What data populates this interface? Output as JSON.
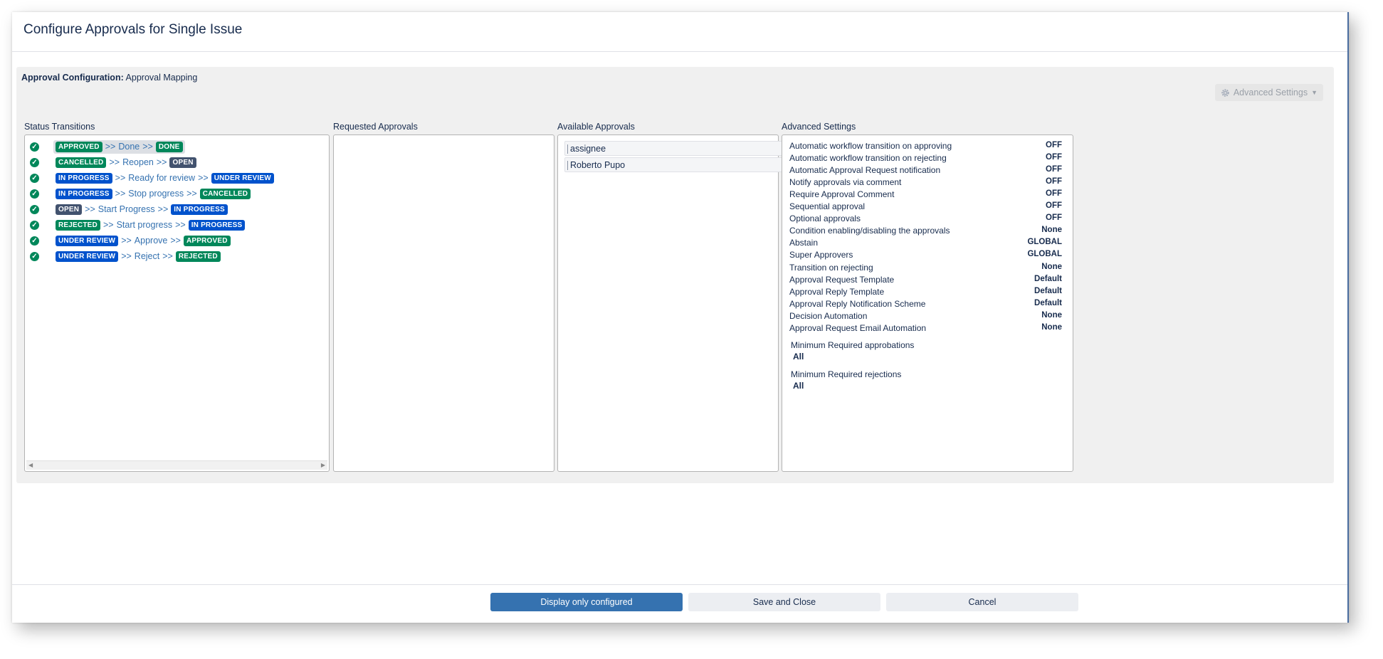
{
  "dialog": {
    "title": "Configure Approvals for Single Issue"
  },
  "config": {
    "label": "Approval Configuration:",
    "value": "Approval Mapping"
  },
  "advanced_button": {
    "label": "Advanced Settings",
    "icon": "gear-icon"
  },
  "columns": {
    "status_transitions": "Status Transitions",
    "requested_approvals": "Requested Approvals",
    "available_approvals": "Available Approvals",
    "advanced_settings": "Advanced Settings"
  },
  "transitions": [
    {
      "from": "APPROVED",
      "from_color": "green",
      "action": "Done",
      "to": "DONE",
      "to_color": "green",
      "selected": true
    },
    {
      "from": "CANCELLED",
      "from_color": "green",
      "action": "Reopen",
      "to": "OPEN",
      "to_color": "dark",
      "selected": false
    },
    {
      "from": "IN PROGRESS",
      "from_color": "blue",
      "action": "Ready for review",
      "to": "UNDER REVIEW",
      "to_color": "blue",
      "selected": false
    },
    {
      "from": "IN PROGRESS",
      "from_color": "blue",
      "action": "Stop progress",
      "to": "CANCELLED",
      "to_color": "green",
      "selected": false
    },
    {
      "from": "OPEN",
      "from_color": "dark",
      "action": "Start Progress",
      "to": "IN PROGRESS",
      "to_color": "blue",
      "selected": false
    },
    {
      "from": "REJECTED",
      "from_color": "green",
      "action": "Start progress",
      "to": "IN PROGRESS",
      "to_color": "blue",
      "selected": false
    },
    {
      "from": "UNDER REVIEW",
      "from_color": "blue",
      "action": "Approve",
      "to": "APPROVED",
      "to_color": "green",
      "selected": false
    },
    {
      "from": "UNDER REVIEW",
      "from_color": "blue",
      "action": "Reject",
      "to": "REJECTED",
      "to_color": "green",
      "selected": false
    }
  ],
  "transition_separator": ">>",
  "available_approvals": [
    "assignee",
    "Roberto Pupo"
  ],
  "settings": [
    {
      "label": "Automatic workflow transition on approving",
      "value": "OFF"
    },
    {
      "label": "Automatic workflow transition on rejecting",
      "value": "OFF"
    },
    {
      "label": "Automatic Approval Request notification",
      "value": "OFF"
    },
    {
      "label": "Notify approvals via comment",
      "value": "OFF"
    },
    {
      "label": "Require Approval Comment",
      "value": "OFF"
    },
    {
      "label": "Sequential approval",
      "value": "OFF"
    },
    {
      "label": "Optional approvals",
      "value": "OFF"
    },
    {
      "label": "Condition enabling/disabling the approvals",
      "value": "None"
    },
    {
      "label": "Abstain",
      "value": "GLOBAL"
    },
    {
      "label": "Super Approvers",
      "value": "GLOBAL"
    },
    {
      "label": "Transition on rejecting",
      "value": "None"
    },
    {
      "label": "Approval Request Template",
      "value": "Default"
    },
    {
      "label": "Approval Reply Template",
      "value": "Default"
    },
    {
      "label": "Approval Reply Notification Scheme",
      "value": "Default"
    },
    {
      "label": "Decision Automation",
      "value": "None"
    },
    {
      "label": "Approval Request Email Automation",
      "value": "None"
    }
  ],
  "minimums": {
    "approbations_label": "Minimum Required approbations",
    "approbations_value": "All",
    "rejections_label": "Minimum Required rejections",
    "rejections_value": "All"
  },
  "footer": {
    "display_only": "Display only configured",
    "save_close": "Save and Close",
    "cancel": "Cancel"
  },
  "colors": {
    "primary": "#3572b0",
    "green": "#00875a",
    "blue": "#0052cc",
    "dark": "#42526e"
  }
}
